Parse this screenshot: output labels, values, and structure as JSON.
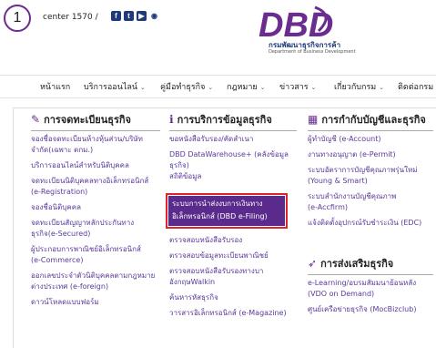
{
  "step_number": "1",
  "header": {
    "call_center": "center  1570 /",
    "social_icons": [
      "facebook-icon",
      "twitter-icon",
      "youtube-icon",
      "rss-icon"
    ],
    "logo_text": "DBD",
    "logo_title": "กรมพัฒนาธุรกิจการค้า",
    "logo_subtitle": "Department of Business Development",
    "brand_color": "#6a2c8e"
  },
  "nav": [
    {
      "label": "หน้าแรก",
      "chevron": ""
    },
    {
      "label": "บริการออนไลน์",
      "chevron": "⌄"
    },
    {
      "label": "คู่มือทำธุรกิจ",
      "chevron": "⌄"
    },
    {
      "label": "กฎหมาย",
      "chevron": "⌄"
    },
    {
      "label": "ข่าวสาร",
      "chevron": "⌄"
    },
    {
      "label": "เกี่ยวกับกรม",
      "chevron": "⌄"
    },
    {
      "label": "ติดต่อกรม",
      "chevron": ""
    }
  ],
  "columns": {
    "registration": {
      "title": "การจดทะเบียนธุรกิจ",
      "links": [
        "จองชื่อจดทะเบียนห้างหุ้นส่วน/บริษัท",
        "จำกัด(เฉพาะ ตกม.)",
        "บริการออนไลน์สำหรับนิติบุคคล",
        "จดทะเบียนนิติบุคคลทางอิเล็กทรอนิกส์",
        "(e-Registration)",
        "จองชื่อนิติบุคคล",
        "จดทะเบียนสัญญาหลักประกันทาง",
        "ธุรกิจ(e-Secured)",
        "ผู้ประกอบการพาณิชย์อิเล็กทรอนิกส์",
        "(e-Commerce)",
        "ออกเลขประจำตัวนิติบุคคลตามกฎหมาย",
        "ต่างประเทศ (e-foreign)",
        "ดาวน์โหลดแบบฟอร์ม"
      ]
    },
    "information": {
      "title": "การบริการข้อมูลธุรกิจ",
      "links_top": [
        "ขอหนังสือรับรอง/คัดสำเนา",
        "DBD DataWarehouse+ (คลังข้อมูล",
        "ธุรกิจ)",
        "สถิติข้อมูล"
      ],
      "highlight": [
        "ระบบการนำส่งงบการเงินทาง",
        "อิเล็กทรอนิกส์ (DBD e-Filing)"
      ],
      "links_bottom": [
        "ตรวจสอบหนังสือรับรอง",
        "ตรวจสอบข้อมูลทะเบียนพาณิชย์",
        "ตรวจสอบหนังสือรับรองทางบา",
        "อังกฤษWalkin",
        "ค้นหารหัสธุรกิจ",
        "วารสารอิเล็กทรอนิกส์ (e-Magazine)"
      ]
    },
    "accounting": {
      "title": "การกำกับบัญชีและธุรกิจ",
      "links": [
        "ผู้ทำบัญชี (e-Account)",
        "งานทางอนุญาต (e-Permit)",
        "ระบบอัตราการบัญชีคุณภาพรุ่นใหม่",
        "(Young & Smart)",
        "ระบบสำนักงานบัญชีคุณภาพ",
        "(e-Accfirm)",
        "แจ้งติดตั้งอุปกรณ์รับชำระเงิน (EDC)"
      ]
    },
    "promotion": {
      "title": "การส่งเสริมธุรกิจ",
      "links": [
        "e-Learning/อบรมสัมมนาย้อนหลัง",
        "(VDO on Demand)",
        "ศูนย์เครือข่ายธุรกิจ (MocBizclub)"
      ]
    }
  },
  "highlight_color": "#e0242e"
}
